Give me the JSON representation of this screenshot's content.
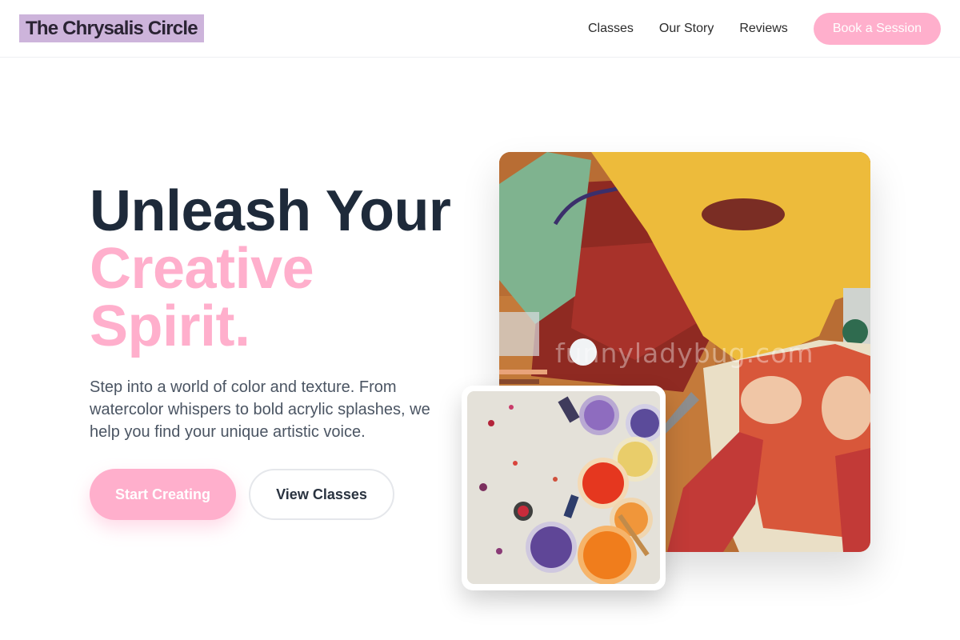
{
  "header": {
    "logo": "The Chrysalis Circle",
    "nav": [
      "Classes",
      "Our Story",
      "Reviews"
    ],
    "cta": "Book a Session"
  },
  "hero": {
    "title_line1": "Unleash Your",
    "title_line2": "Creative",
    "title_line3": "Spirit.",
    "description": "Step into a world of color and texture. From watercolor whispers to bold acrylic splashes, we help you find your unique artistic voice.",
    "primary_button": "Start Creating",
    "secondary_button": "View Classes"
  },
  "images": {
    "main_watermark": "funnyladybug.com"
  },
  "colors": {
    "accent_pink": "#ffafcc",
    "logo_bg": "#cdb4db",
    "heading_dark": "#1e2a3a"
  }
}
